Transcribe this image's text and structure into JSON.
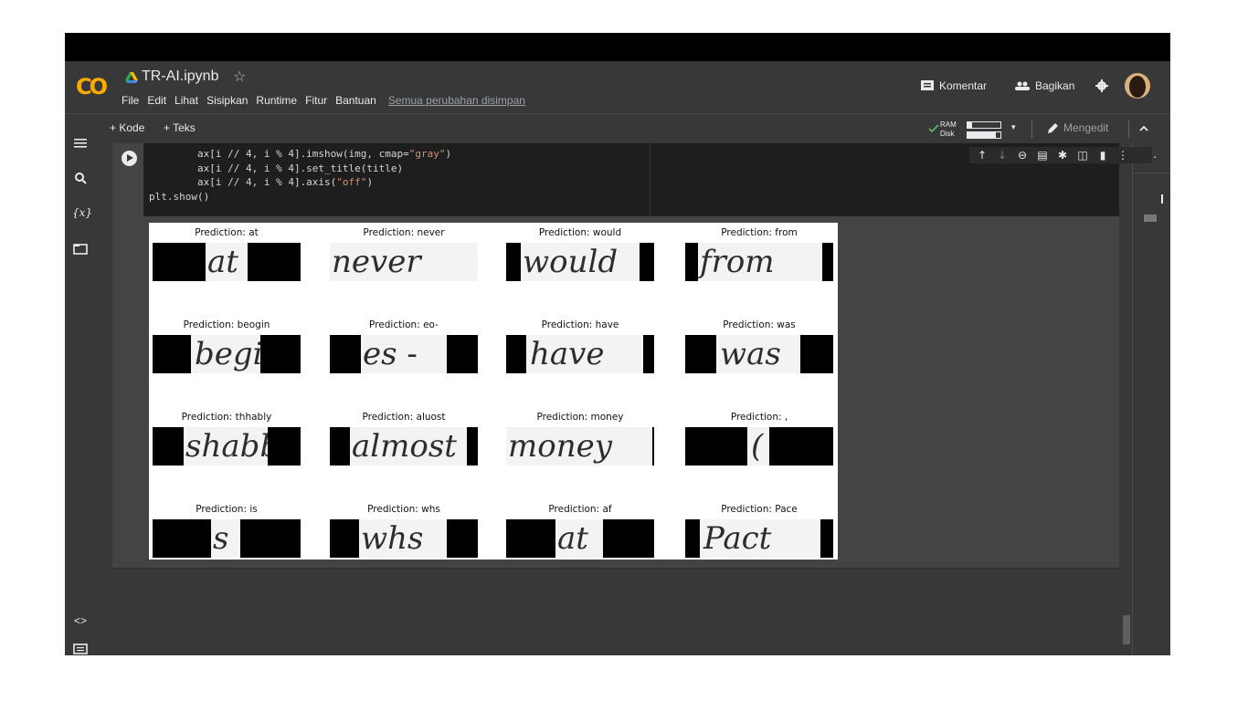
{
  "app": {
    "logo": "CO",
    "notebook_title": "TR-AI.ipynb",
    "star": "☆"
  },
  "menu": {
    "items": [
      "File",
      "Edit",
      "Lihat",
      "Sisipkan",
      "Runtime",
      "Fitur",
      "Bantuan"
    ],
    "saved_status": "Semua perubahan disimpan"
  },
  "header_actions": {
    "comment_label": "Komentar",
    "share_label": "Bagikan"
  },
  "toolbar": {
    "add_code": "+ Kode",
    "add_text": "+ Teks",
    "ram_label": "RAM",
    "disk_label": "Disk",
    "ram_usage": 0.15,
    "disk_usage": 0.85,
    "edit_mode": "Mengedit"
  },
  "code": {
    "line1_a": "        ax[i // 4, i % 4].imshow(img, cmap=",
    "line1_str": "\"gray\"",
    "line1_b": ")",
    "line2": "        ax[i // 4, i % 4].set_title(title)",
    "line3_a": "        ax[i // 4, i % 4].axis(",
    "line3_str": "\"off\"",
    "line3_b": ")",
    "line4": "plt.show()"
  },
  "predictions": [
    {
      "title": "Prediction: at",
      "word": "at"
    },
    {
      "title": "Prediction: never",
      "word": "never"
    },
    {
      "title": "Prediction: would",
      "word": "would"
    },
    {
      "title": "Prediction: from",
      "word": "from"
    },
    {
      "title": "Prediction: beogin",
      "word": "begin"
    },
    {
      "title": "Prediction: eo-",
      "word": "es -"
    },
    {
      "title": "Prediction: have",
      "word": "have"
    },
    {
      "title": "Prediction: was",
      "word": "was"
    },
    {
      "title": "Prediction: thhably",
      "word": "shabby"
    },
    {
      "title": "Prediction: aluost",
      "word": "almost"
    },
    {
      "title": "Prediction: money",
      "word": "money"
    },
    {
      "title": "Prediction: ,",
      "word": "("
    },
    {
      "title": "Prediction: is",
      "word": "s"
    },
    {
      "title": "Prediction: whs",
      "word": "whs"
    },
    {
      "title": "Prediction: af",
      "word": "at"
    },
    {
      "title": "Prediction: Pace",
      "word": "Pact"
    }
  ],
  "icons": {
    "run": "play-icon",
    "toc": "list-icon",
    "search": "search-icon",
    "variables": "{x}",
    "files": "folder-icon",
    "snippets": "<>",
    "terminal": "terminal-icon"
  }
}
